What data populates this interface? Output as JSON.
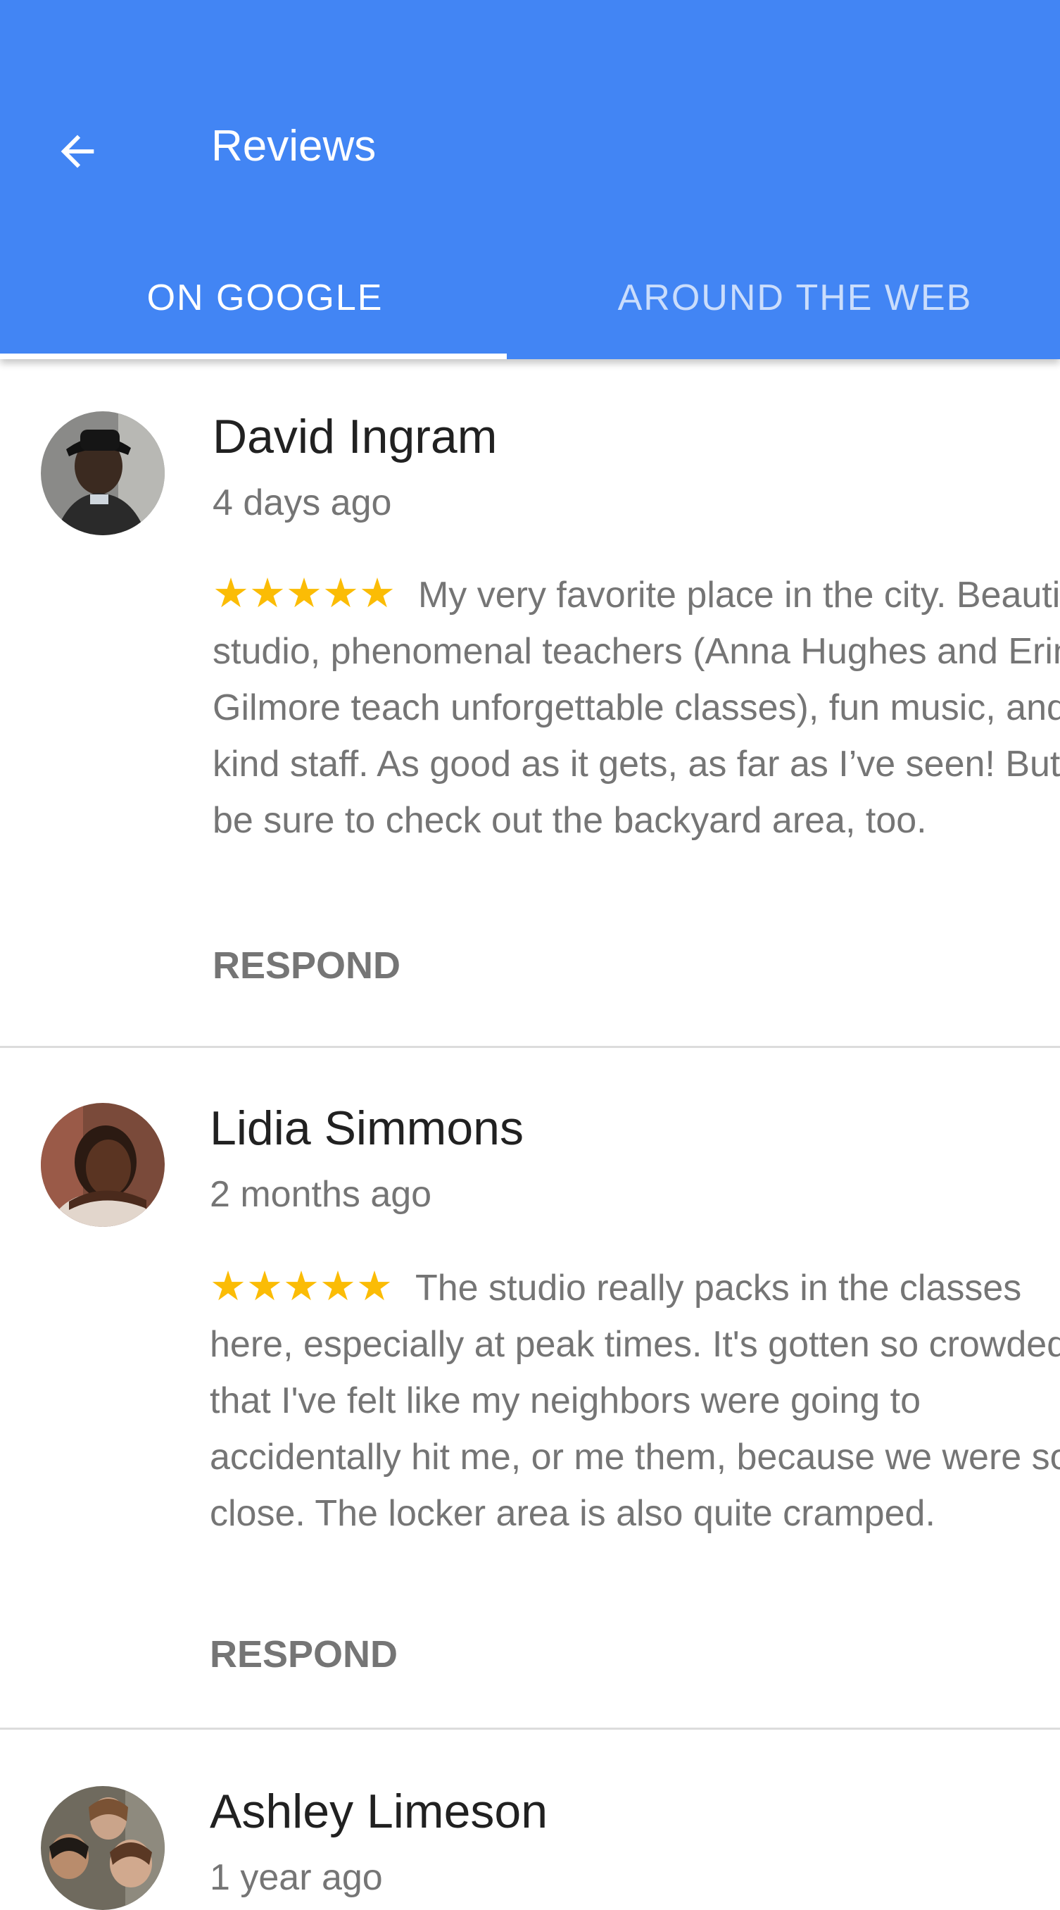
{
  "header": {
    "title": "Reviews",
    "back_icon": "arrow-back-icon",
    "background_color": "#4285f4"
  },
  "tabs": [
    {
      "label": "ON GOOGLE",
      "active": true
    },
    {
      "label": "AROUND THE WEB",
      "active": false
    }
  ],
  "reviews": [
    {
      "author": "David Ingram",
      "date": "4 days ago",
      "rating": 5,
      "stars": "★★★★★",
      "text": "My very favorite place in the city. Beautiful studio, phenomenal teachers (Anna Hughes and Erin Gilmore teach unforgettable classes), fun music, and kind staff. As good as it gets, as far as I’ve seen! But be sure to check out the backyard area, too.",
      "action": "RESPOND"
    },
    {
      "author": "Lidia Simmons",
      "date": "2 months ago",
      "rating": 5,
      "stars": "★★★★★",
      "text": "The studio really packs in the classes here, especially at peak times. It's gotten so crowded that I've felt like my neighbors were going to accidentally hit me, or me them, because we were so close. The locker area is also quite cramped.",
      "action": "RESPOND"
    },
    {
      "author": "Ashley Limeson",
      "date": "1 year ago"
    }
  ],
  "colors": {
    "star": "#fbbc05",
    "primary": "#4285f4"
  }
}
